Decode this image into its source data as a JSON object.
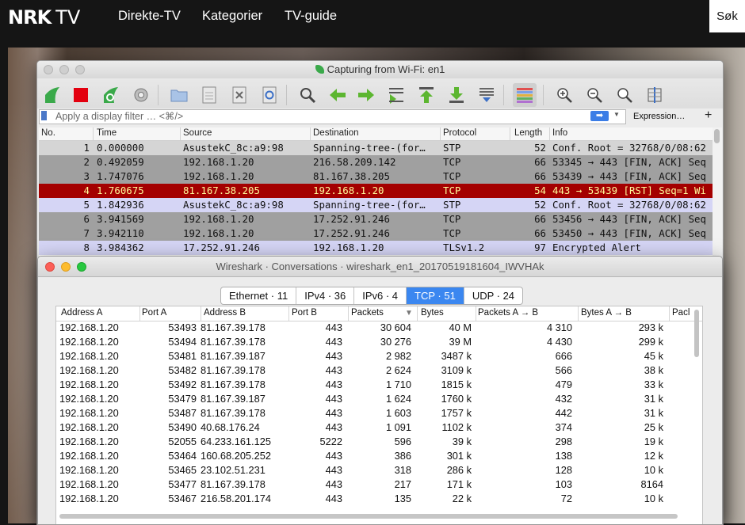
{
  "nrk": {
    "logo": "NRK",
    "logo_tv": "TV",
    "nav": [
      "Direkte-TV",
      "Kategorier",
      "TV-guide"
    ],
    "search": "Søk"
  },
  "wireshark": {
    "title": "Capturing from Wi-Fi: en1",
    "filter_placeholder": "Apply a display filter … <⌘/>",
    "apply_arrow": "➡",
    "expression_label": "Expression…",
    "plus": "+",
    "columns": [
      "No.",
      "Time",
      "Source",
      "Destination",
      "Protocol",
      "Length",
      "Info"
    ],
    "packets": [
      {
        "no": "1",
        "time": "0.000000",
        "src": "AsustekC_8c:a9:98",
        "dst": "Spanning-tree-(for…",
        "proto": "STP",
        "len": "52",
        "info": "Conf. Root = 32768/0/08:62",
        "style": "lgray"
      },
      {
        "no": "2",
        "time": "0.492059",
        "src": "192.168.1.20",
        "dst": "216.58.209.142",
        "proto": "TCP",
        "len": "66",
        "info": "53345 → 443 [FIN, ACK] Seq",
        "style": "gray"
      },
      {
        "no": "3",
        "time": "1.747076",
        "src": "192.168.1.20",
        "dst": "81.167.38.205",
        "proto": "TCP",
        "len": "66",
        "info": "53439 → 443 [FIN, ACK] Seq",
        "style": "gray"
      },
      {
        "no": "4",
        "time": "1.760675",
        "src": "81.167.38.205",
        "dst": "192.168.1.20",
        "proto": "TCP",
        "len": "54",
        "info": "443 → 53439 [RST] Seq=1 Wi",
        "style": "red"
      },
      {
        "no": "5",
        "time": "1.842936",
        "src": "AsustekC_8c:a9:98",
        "dst": "Spanning-tree-(for…",
        "proto": "STP",
        "len": "52",
        "info": "Conf. Root = 32768/0/08:62",
        "style": "lav"
      },
      {
        "no": "6",
        "time": "3.941569",
        "src": "192.168.1.20",
        "dst": "17.252.91.246",
        "proto": "TCP",
        "len": "66",
        "info": "53456 → 443 [FIN, ACK] Seq",
        "style": "gray"
      },
      {
        "no": "7",
        "time": "3.942110",
        "src": "192.168.1.20",
        "dst": "17.252.91.246",
        "proto": "TCP",
        "len": "66",
        "info": "53450 → 443 [FIN, ACK] Seq",
        "style": "gray"
      },
      {
        "no": "8",
        "time": "3.984362",
        "src": "17.252.91.246",
        "dst": "192.168.1.20",
        "proto": "TLSv1.2",
        "len": "97",
        "info": "Encrypted Alert",
        "style": "lav"
      }
    ]
  },
  "conversations": {
    "title": "Wireshark · Conversations · wireshark_en1_20170519181604_IWVHAk",
    "tabs": [
      "Ethernet · 11",
      "IPv4 · 36",
      "IPv6 · 4",
      "TCP · 51",
      "UDP · 24"
    ],
    "active_tab": "TCP · 51",
    "columns": [
      "Address A",
      "Port A",
      "Address B",
      "Port B",
      "Packets",
      "Bytes",
      "Packets A → B",
      "Bytes A → B",
      "Pacl"
    ],
    "sort_arrow": "▼",
    "rows": [
      [
        "192.168.1.20",
        "53493",
        "81.167.39.178",
        "443",
        "30 604",
        "40 M",
        "4 310",
        "293 k"
      ],
      [
        "192.168.1.20",
        "53494",
        "81.167.39.178",
        "443",
        "30 276",
        "39 M",
        "4 430",
        "299 k"
      ],
      [
        "192.168.1.20",
        "53481",
        "81.167.39.187",
        "443",
        "2 982",
        "3487 k",
        "666",
        "45 k"
      ],
      [
        "192.168.1.20",
        "53482",
        "81.167.39.178",
        "443",
        "2 624",
        "3109 k",
        "566",
        "38 k"
      ],
      [
        "192.168.1.20",
        "53492",
        "81.167.39.178",
        "443",
        "1 710",
        "1815 k",
        "479",
        "33 k"
      ],
      [
        "192.168.1.20",
        "53479",
        "81.167.39.187",
        "443",
        "1 624",
        "1760 k",
        "432",
        "31 k"
      ],
      [
        "192.168.1.20",
        "53487",
        "81.167.39.178",
        "443",
        "1 603",
        "1757 k",
        "442",
        "31 k"
      ],
      [
        "192.168.1.20",
        "53490",
        "40.68.176.24",
        "443",
        "1 091",
        "1102 k",
        "374",
        "25 k"
      ],
      [
        "192.168.1.20",
        "52055",
        "64.233.161.125",
        "5222",
        "596",
        "39 k",
        "298",
        "19 k"
      ],
      [
        "192.168.1.20",
        "53464",
        "160.68.205.252",
        "443",
        "386",
        "301 k",
        "138",
        "12 k"
      ],
      [
        "192.168.1.20",
        "53465",
        "23.102.51.231",
        "443",
        "318",
        "286 k",
        "128",
        "10 k"
      ],
      [
        "192.168.1.20",
        "53477",
        "81.167.39.178",
        "443",
        "217",
        "171 k",
        "103",
        "8164"
      ],
      [
        "192.168.1.20",
        "53467",
        "216.58.201.174",
        "443",
        "135",
        "22 k",
        "72",
        "10 k"
      ]
    ]
  }
}
